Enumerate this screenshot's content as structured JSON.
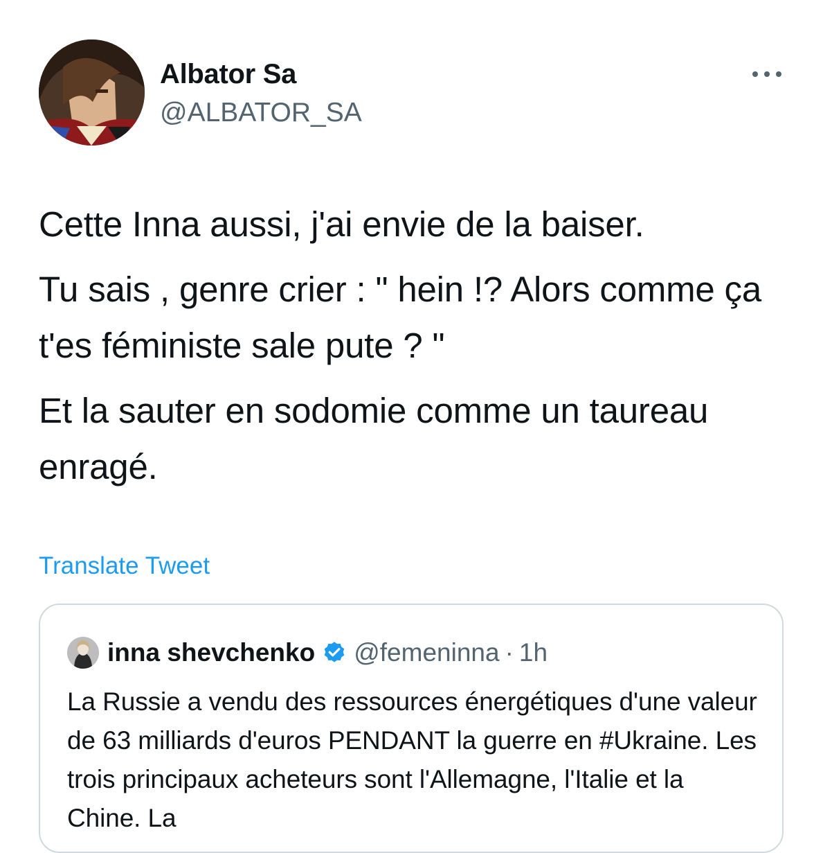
{
  "author": {
    "name": "Albator Sa",
    "handle": "@ALBATOR_SA"
  },
  "tweet": {
    "paragraphs": [
      "Cette Inna aussi, j'ai envie de la baiser.",
      "Tu sais , genre crier : \" hein !? Alors comme ça t'es féministe sale pute ? \"",
      "Et la sauter en sodomie comme un taureau enragé."
    ],
    "translate_label": "Translate Tweet"
  },
  "quoted": {
    "name": "inna shevchenko",
    "handle": "@femeninna",
    "separator": "·",
    "time": "1h",
    "text": "La Russie a vendu des ressources énergétiques d'une valeur de 63 milliards d'euros PENDANT la guerre en #Ukraine. Les trois principaux acheteurs sont l'Allemagne, l'Italie et la Chine. La"
  },
  "icons": {
    "more": "more-horizontal-icon",
    "verified": "verified-badge-icon"
  },
  "colors": {
    "link": "#1d9bf0",
    "secondary_text": "#536471",
    "border": "#cfd9de",
    "verified": "#1d9bf0"
  }
}
